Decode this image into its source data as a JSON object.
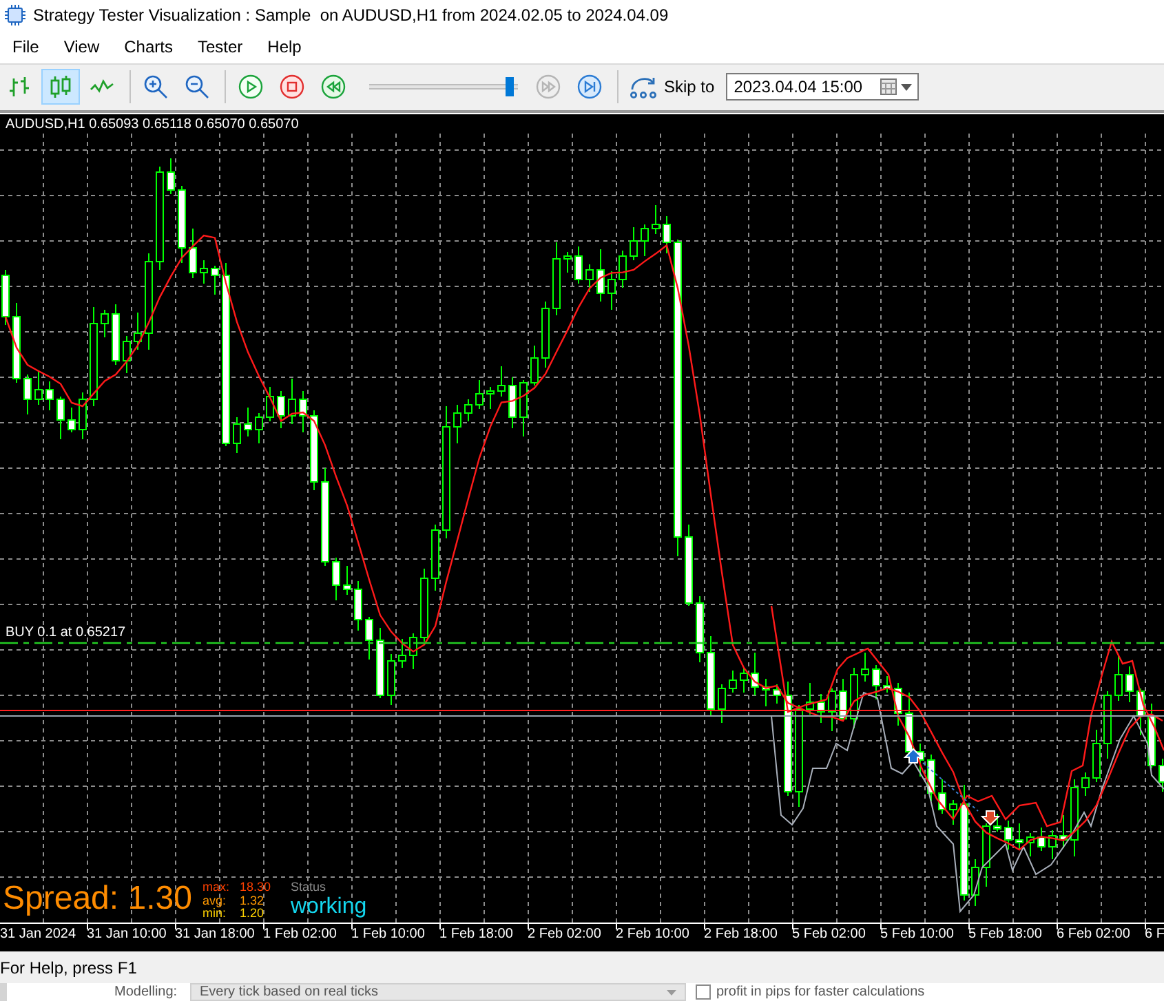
{
  "window": {
    "title": "Strategy Tester Visualization : Sample  on AUDUSD,H1 from 2024.02.05 to 2024.04.09"
  },
  "menu": [
    {
      "label": "File"
    },
    {
      "label": "View"
    },
    {
      "label": "Charts"
    },
    {
      "label": "Tester"
    },
    {
      "label": "Help"
    }
  ],
  "toolbar": {
    "chart_types": [
      {
        "kind": "bars",
        "selected": false
      },
      {
        "kind": "candles",
        "selected": true
      },
      {
        "kind": "line",
        "selected": false
      }
    ],
    "playback": [
      {
        "kind": "play",
        "disabled": false
      },
      {
        "kind": "stop",
        "disabled": false
      },
      {
        "kind": "rewind",
        "disabled": false
      }
    ],
    "speed_slider": {
      "level": 0.97
    },
    "stepping": [
      {
        "kind": "fast_forward",
        "disabled": true
      },
      {
        "kind": "step_end",
        "disabled": false
      }
    ],
    "skip": {
      "label": "Skip to",
      "value": "2023.04.04 15:00"
    }
  },
  "chart": {
    "header": "AUDUSD,H1 0.65093 0.65118 0.65070 0.65070",
    "order_label": "BUY 0.1 at 0.65217",
    "spread": {
      "label": "Spread: 1.30",
      "stats": [
        {
          "label": "max:",
          "value": "18.30",
          "color": "#ff4000"
        },
        {
          "label": "avg:",
          "value": "1.32",
          "color": "#ff9900"
        },
        {
          "label": "min:",
          "value": "1.20",
          "color": "#ffd200"
        }
      ]
    },
    "status": {
      "label": "Status",
      "value": "working"
    },
    "x_axis": [
      "31 Jan 2024",
      "31 Jan 10:00",
      "31 Jan 18:00",
      "1 Feb 02:00",
      "1 Feb 10:00",
      "1 Feb 18:00",
      "2 Feb 02:00",
      "2 Feb 10:00",
      "2 Feb 18:00",
      "5 Feb 02:00",
      "5 Feb 10:00",
      "5 Feb 18:00",
      "6 Feb 02:00",
      "6 F"
    ]
  },
  "status_bar": {
    "text": "For Help, press F1"
  },
  "background_panel": {
    "modelling_label": "Modelling:",
    "modelling_value": "Every tick based on real ticks",
    "option": {
      "label": "profit in pips for faster calculations",
      "checked": false
    }
  }
}
